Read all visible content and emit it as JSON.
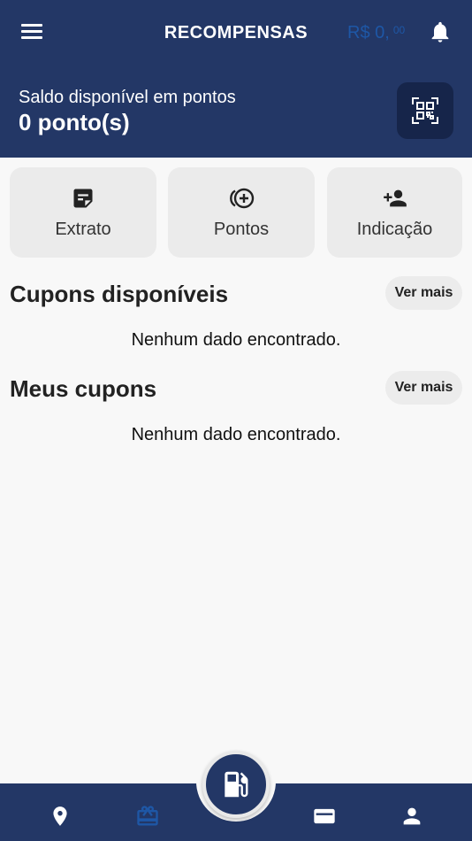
{
  "header": {
    "title": "RECOMPENSAS",
    "balance_main": "R$ 0,",
    "balance_cents": "00",
    "points_label": "Saldo disponível em pontos",
    "points_value": "0 ponto(s)"
  },
  "actions": [
    {
      "label": "Extrato",
      "icon": "statement-icon"
    },
    {
      "label": "Pontos",
      "icon": "add-points-icon"
    },
    {
      "label": "Indicação",
      "icon": "add-person-icon"
    }
  ],
  "sections": {
    "available_coupons": {
      "title": "Cupons disponíveis",
      "more_label": "Ver mais",
      "empty_text": "Nenhum dado encontrado."
    },
    "my_coupons": {
      "title": "Meus cupons",
      "more_label": "Ver mais",
      "empty_text": "Nenhum dado encontrado."
    }
  },
  "bottom_nav": {
    "items": [
      "location-pin-icon",
      "gift-icon",
      "wallet-icon",
      "profile-icon"
    ],
    "active": "gift-icon",
    "center_button": "fuel-pump-icon"
  },
  "colors": {
    "header_bg": "#233766",
    "accent_blue": "#1e57a6",
    "card_bg": "#ebebeb",
    "page_bg": "#f8f8f8"
  }
}
